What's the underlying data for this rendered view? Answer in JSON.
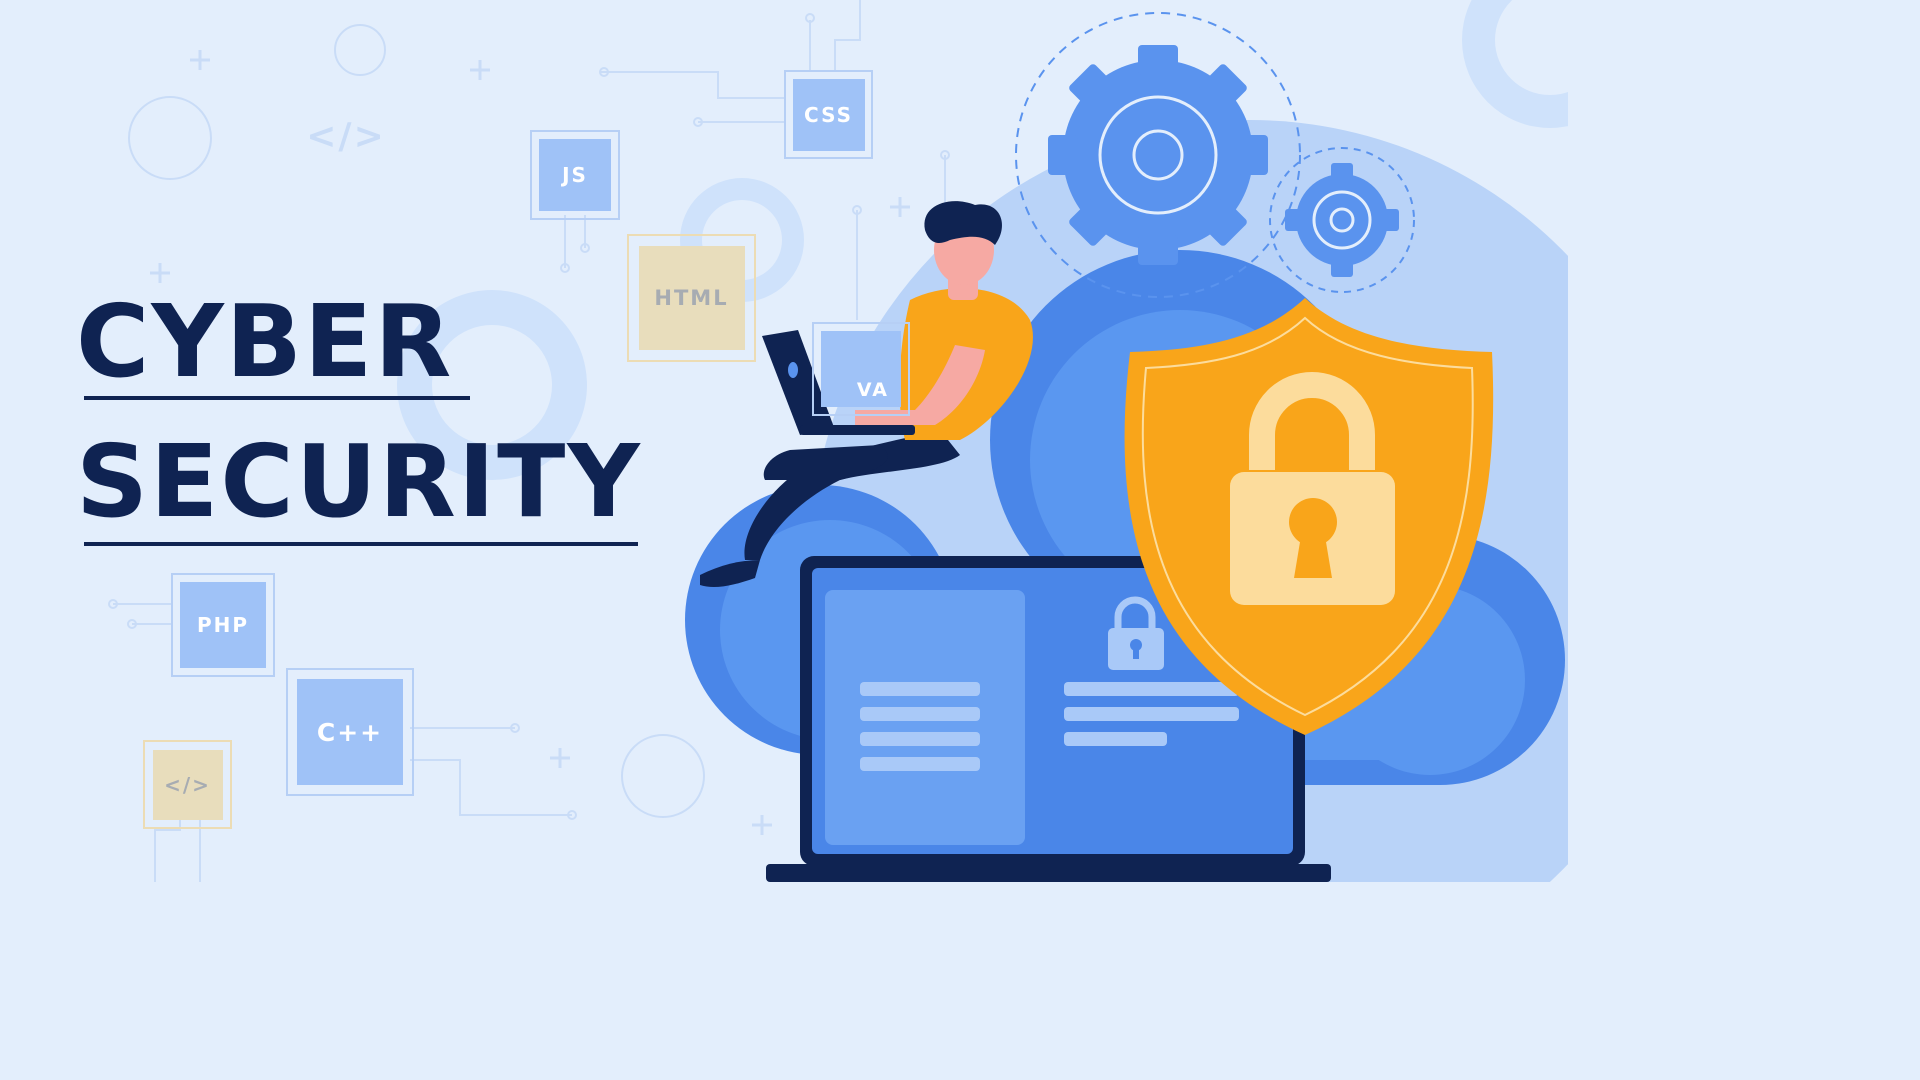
{
  "title": {
    "line1": "CYBER",
    "line2": "SECURITY"
  },
  "code_tags": {
    "css": "CSS",
    "js": "JS",
    "html": "HTML",
    "java": "VA",
    "php": "PHP",
    "cpp": "C++",
    "code_symbol": "</>",
    "bg_symbol": "</>"
  },
  "colors": {
    "background": "#e3eefc",
    "title": "#0f2352",
    "cloud": "#5a93ee",
    "shield": "#f9a51a",
    "lock": "#fcdc9c",
    "gear": "#5a93ee",
    "laptop_frame": "#0f2352",
    "shirt": "#f9a51a"
  },
  "icons": [
    "gear-icon",
    "shield-icon",
    "padlock-icon",
    "cloud-icon",
    "laptop-icon",
    "person-illustration"
  ]
}
